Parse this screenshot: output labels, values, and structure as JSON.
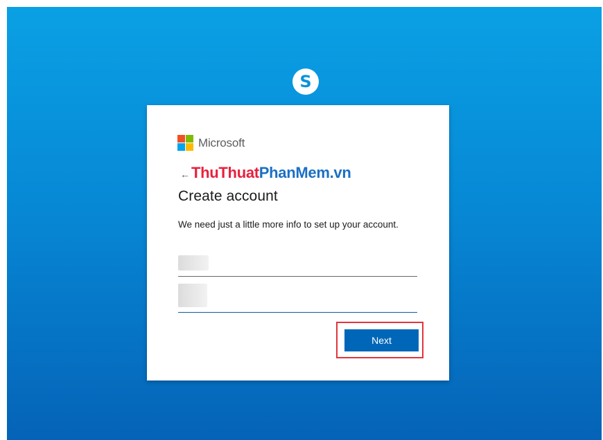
{
  "app": {
    "logo_glyph": "S",
    "logo_icon": "skype-logo-icon"
  },
  "brand": {
    "name": "Microsoft",
    "logo_colors": [
      "#f25022",
      "#7fba00",
      "#00a4ef",
      "#ffb900"
    ]
  },
  "navigation": {
    "back_glyph": "←",
    "back_icon": "arrow-left-icon"
  },
  "watermark": {
    "part1": "ThuThuat",
    "part2": "PhanMem.vn"
  },
  "form": {
    "title": "Create account",
    "description": "We need just a little more info to set up your account.",
    "fields": [
      {
        "value": "",
        "placeholder": ""
      },
      {
        "value": "",
        "placeholder": ""
      }
    ],
    "next_label": "Next"
  },
  "colors": {
    "background_top": "#0aa0e4",
    "background_bottom": "#0563b7",
    "primary_button": "#0067b8",
    "highlight_box": "#e0343d"
  }
}
